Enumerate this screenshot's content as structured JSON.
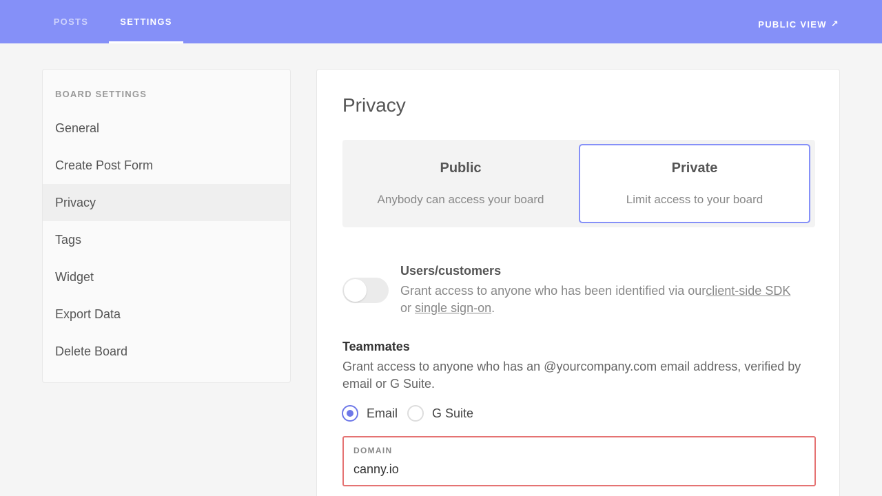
{
  "nav": {
    "tabs": [
      {
        "label": "POSTS",
        "active": false
      },
      {
        "label": "SETTINGS",
        "active": true
      }
    ],
    "public_view": "PUBLIC VIEW",
    "public_view_icon": "external-arrow-icon",
    "accent_color": "#8590f8"
  },
  "sidebar": {
    "heading": "BOARD SETTINGS",
    "items": [
      {
        "label": "General"
      },
      {
        "label": "Create Post Form"
      },
      {
        "label": "Privacy",
        "active": true
      },
      {
        "label": "Tags"
      },
      {
        "label": "Widget"
      },
      {
        "label": "Export Data"
      },
      {
        "label": "Delete Board"
      }
    ]
  },
  "main": {
    "title": "Privacy",
    "privacy_options": {
      "public": {
        "title": "Public",
        "desc": "Anybody can access your board"
      },
      "private": {
        "title": "Private",
        "desc": "Limit access to your board",
        "selected": true
      }
    },
    "users": {
      "title": "Users/customers",
      "text_before": "Grant access to anyone who has been identified via our",
      "sdk_link": "client-side SDK",
      "text_or": "or",
      "sso_link": "single sign-on",
      "text_end": ".",
      "toggle_on": false
    },
    "teammates": {
      "title": "Teammates",
      "text": "Grant access to anyone who has an @yourcompany.com email address, verified by email or G Suite."
    },
    "verification": {
      "options": [
        {
          "label": "Email",
          "checked": true
        },
        {
          "label": "G Suite",
          "checked": false
        }
      ]
    },
    "domain": {
      "label": "DOMAIN",
      "value": "canny.io",
      "error_color": "#e57373"
    }
  }
}
